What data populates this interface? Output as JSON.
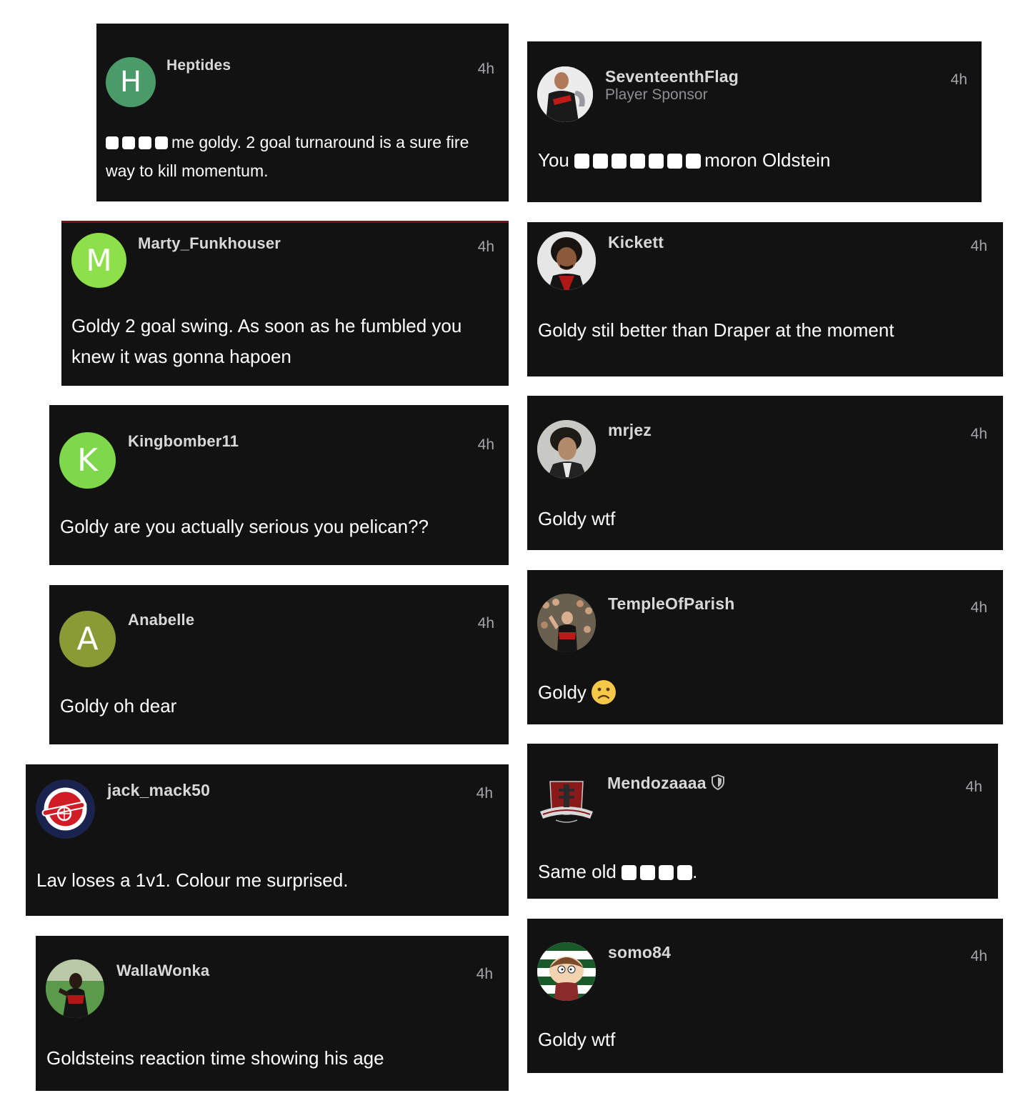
{
  "time_label": "4h",
  "colors": {
    "card_bg": "#121212",
    "heptides_avatar": "#4a9a6a",
    "marty_avatar": "#8ee04a",
    "kingbomber_avatar": "#7fd84c",
    "anabelle_avatar": "#8a9a34"
  },
  "comments": {
    "heptides": {
      "avatar_letter": "H",
      "username": "Heptides",
      "time": "4h",
      "text_before": "",
      "censored_count": 4,
      "text_after": "me goldy. 2 goal turnaround is a sure fire way to kill momentum."
    },
    "seventeenthflag": {
      "avatar_icon": "player-photo-avatar",
      "username": "SeventeenthFlag",
      "subtitle": "Player Sponsor",
      "time": "4h",
      "text_before": "You",
      "censored_count": 7,
      "text_after": "moron Oldstein"
    },
    "marty": {
      "avatar_letter": "M",
      "username": "Marty_Funkhouser",
      "time": "4h",
      "text": "Goldy 2 goal swing. As soon as he fumbled you knew it was gonna hapoen"
    },
    "kickett": {
      "avatar_icon": "player-photo-avatar",
      "username": "Kickett",
      "time": "4h",
      "text": "Goldy stil better than Draper at the moment"
    },
    "kingbomber": {
      "avatar_letter": "K",
      "username": "Kingbomber11",
      "time": "4h",
      "text": "Goldy are you actually serious you pelican??"
    },
    "mrjez": {
      "avatar_icon": "portrait-photo-avatar",
      "username": "mrjez",
      "time": "4h",
      "text": "Goldy wtf"
    },
    "anabelle": {
      "avatar_letter": "A",
      "username": "Anabelle",
      "time": "4h",
      "text": "Goldy oh dear"
    },
    "templeofparish": {
      "avatar_icon": "crowd-photo-avatar",
      "username": "TempleOfParish",
      "time": "4h",
      "text": "Goldy",
      "emoji_icon": "frowning-face-emoji"
    },
    "jackmack": {
      "avatar_icon": "cannon-roundel-avatar",
      "username": "jack_mack50",
      "time": "4h",
      "text": "Lav loses a 1v1. Colour me surprised."
    },
    "mendoza": {
      "avatar_icon": "club-crest-avatar",
      "username": "Mendozaaaa",
      "badge_icon": "shield-icon",
      "time": "4h",
      "text_before": "Same old",
      "censored_count": 4,
      "text_after": "."
    },
    "wallawonka": {
      "avatar_icon": "player-photo-avatar",
      "username": "WallaWonka",
      "time": "4h",
      "text": "Goldsteins reaction time showing his age"
    },
    "somo": {
      "avatar_icon": "cartoon-character-avatar",
      "username": "somo84",
      "time": "4h",
      "text": "Goldy wtf"
    }
  }
}
